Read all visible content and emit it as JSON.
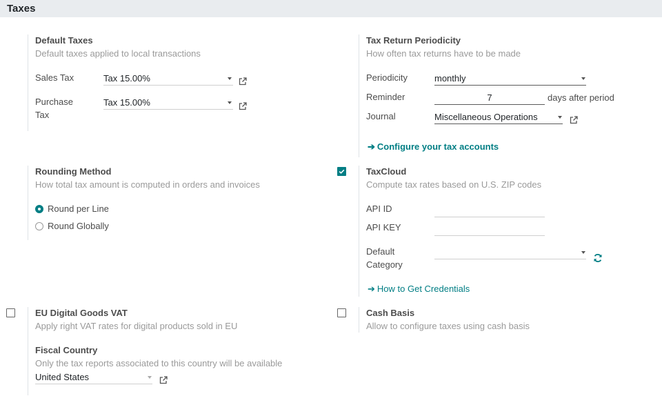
{
  "section": {
    "title": "Taxes"
  },
  "default_taxes": {
    "title": "Default Taxes",
    "desc": "Default taxes applied to local transactions",
    "sales_label": "Sales Tax",
    "sales_value": "Tax 15.00%",
    "purchase_label_1": "Purchase",
    "purchase_label_2": "Tax",
    "purchase_value": "Tax 15.00%"
  },
  "tax_return": {
    "title": "Tax Return Periodicity",
    "desc": "How often tax returns have to be made",
    "periodicity_label": "Periodicity",
    "periodicity_value": "monthly",
    "reminder_label": "Reminder",
    "reminder_value": "7",
    "reminder_suffix": "days after period",
    "journal_label": "Journal",
    "journal_value": "Miscellaneous Operations",
    "configure_link": "Configure your tax accounts"
  },
  "rounding": {
    "title": "Rounding Method",
    "desc": "How total tax amount is computed in orders and invoices",
    "option_line": "Round per Line",
    "option_global": "Round Globally",
    "selected": "Round per Line"
  },
  "taxcloud": {
    "title": "TaxCloud",
    "desc": "Compute tax rates based on U.S. ZIP codes",
    "checked": true,
    "api_id_label": "API ID",
    "api_id_value": "",
    "api_key_label": "API KEY",
    "api_key_value": "",
    "default_category_label_1": "Default",
    "default_category_label_2": "Category",
    "default_category_value": "",
    "credentials_link": "How to Get Credentials"
  },
  "eu_vat": {
    "title": "EU Digital Goods VAT",
    "desc": "Apply right VAT rates for digital products sold in EU",
    "checked": false
  },
  "cash_basis": {
    "title": "Cash Basis",
    "desc": "Allow to configure taxes using cash basis",
    "checked": false
  },
  "fiscal_country": {
    "title": "Fiscal Country",
    "desc": "Only the tax reports associated to this country will be available",
    "value": "United States"
  },
  "icons": {
    "external": "external-link-icon",
    "arrow": "arrow-right-icon",
    "refresh": "refresh-icon",
    "caret": "caret-down-icon"
  },
  "colors": {
    "accent": "#017e84",
    "header_bg": "#e9ecef"
  }
}
